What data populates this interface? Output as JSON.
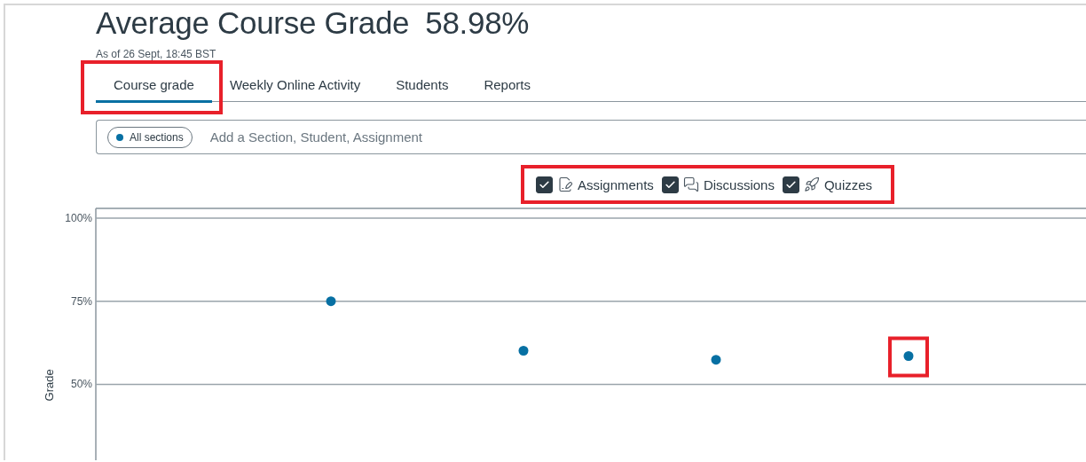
{
  "header": {
    "title": "Average Course Grade",
    "grade": "58.98%",
    "timestamp": "As of 26 Sept, 18:45 BST"
  },
  "tabs": [
    {
      "label": "Course grade",
      "selected": true,
      "highlighted": true
    },
    {
      "label": "Weekly Online Activity",
      "selected": false,
      "highlighted": false
    },
    {
      "label": "Students",
      "selected": false,
      "highlighted": false
    },
    {
      "label": "Reports",
      "selected": false,
      "highlighted": false
    }
  ],
  "filter": {
    "chip": "All sections",
    "placeholder": "Add a Section, Student, Assignment"
  },
  "legend": {
    "highlighted": true,
    "items": [
      {
        "kind": "assignment",
        "label": "Assignments",
        "checked": true
      },
      {
        "kind": "discussion",
        "label": "Discussions",
        "checked": true
      },
      {
        "kind": "quiz",
        "label": "Quizzes",
        "checked": true
      }
    ]
  },
  "chart": {
    "highlighted_points": [
      false,
      false,
      false,
      true
    ],
    "chart_data": {
      "type": "scatter",
      "ylabel": "Grade",
      "grid": true,
      "categories": [
        null,
        null,
        null,
        null
      ],
      "ylim": [
        26.9,
        102.9
      ],
      "yticks": [
        {
          "value": 50,
          "label": "50%"
        },
        {
          "value": 75,
          "label": "75%"
        },
        {
          "value": 100,
          "label": "100%"
        }
      ],
      "values": [
        75,
        60.1,
        57.4,
        58.5
      ]
    }
  }
}
